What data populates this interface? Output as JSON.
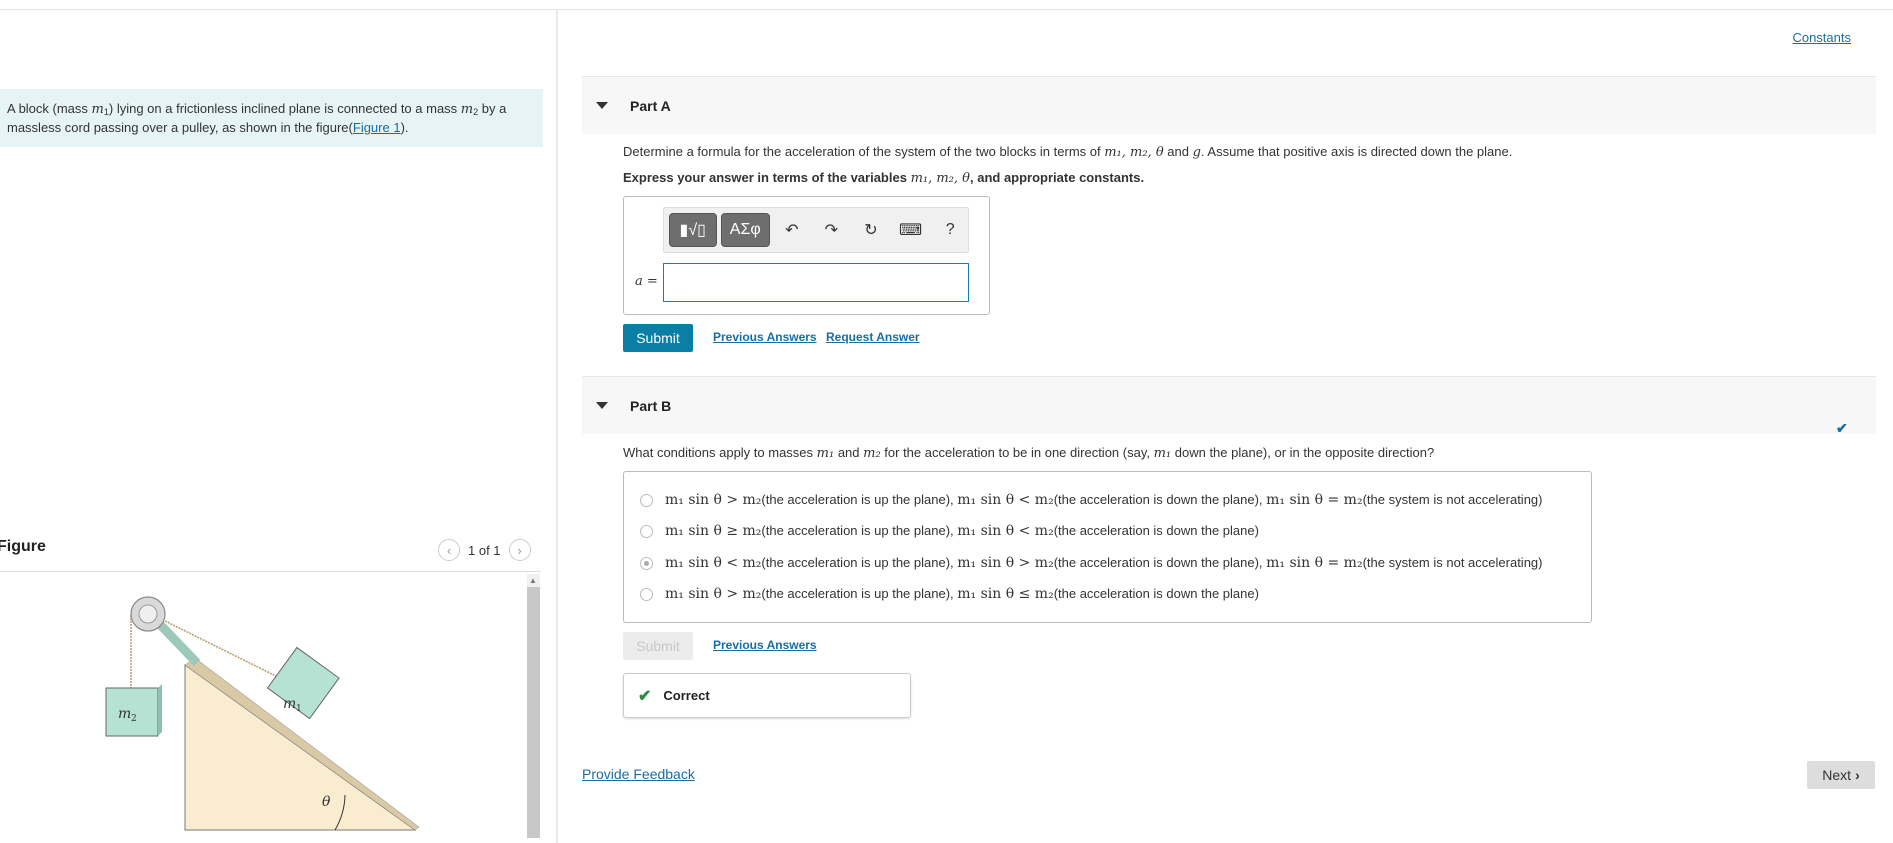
{
  "left": {
    "intro": {
      "pre": "A block (mass ",
      "m1_var": "m",
      "m1_sub": "1",
      "mid": ") lying on a frictionless inclined plane is connected to a mass ",
      "m2_var": "m",
      "m2_sub": "2",
      "post": " by a massless cord passing over a pulley, as shown in the figure(",
      "fig_link": "Figure 1",
      "end": ")."
    },
    "figure_title": "Figure",
    "pager": {
      "text": "1 of 1",
      "prev_icon": "chevron-left-icon",
      "next_icon": "chevron-right-icon"
    },
    "figure_labels": {
      "m1": "m",
      "m1_sub": "1",
      "m2": "m",
      "m2_sub": "2",
      "theta": "θ"
    },
    "colors": {
      "incline": "#faedcf",
      "block": "#b5e2d2",
      "pulley": "#d9d9d9"
    }
  },
  "right": {
    "constants_link": "Constants",
    "partA": {
      "title": "Part A",
      "question_pre": "Determine a formula for the acceleration of the system of the two blocks in terms of ",
      "question_vars": "m₁, m₂, θ",
      "question_and": " and ",
      "question_g": "g",
      "question_post": ". Assume that positive axis is directed down the plane.",
      "instruction_pre": "Express your answer in terms of the variables ",
      "instruction_vars": "m₁, m₂, θ",
      "instruction_post": ", and appropriate constants.",
      "toolbar": {
        "template_icon": "▮√▯",
        "symbols_label": "ΑΣφ",
        "undo_icon": "↶",
        "redo_icon": "↷",
        "reset_icon": "↻",
        "keyboard_icon": "⌨",
        "help_label": "?"
      },
      "answer_label": "a =",
      "answer_value": "",
      "submit": "Submit",
      "previous_answers": "Previous Answers",
      "request_answer": "Request Answer"
    },
    "partB": {
      "title": "Part B",
      "question_pre": "What conditions apply to masses ",
      "question_m1": "m₁",
      "question_and": " and ",
      "question_m2": "m₂",
      "question_mid": " for the acceleration to be in one direction (say, ",
      "question_m1b": "m₁",
      "question_post": " down the plane), or in the opposite direction?",
      "options": [
        {
          "parts": [
            [
              "m",
              "m₁ sin θ > m₂"
            ],
            [
              "t",
              "(the acceleration is up the plane), "
            ],
            [
              "m",
              "m₁ sin  θ  <  m₂"
            ],
            [
              "t",
              "(the acceleration is down the plane), "
            ],
            [
              "m",
              "m₁ sin  θ  =  m₂"
            ],
            [
              "t",
              "(the system is not accelerating)"
            ]
          ],
          "selected": false
        },
        {
          "parts": [
            [
              "m",
              "m₁ sin  θ  ≥  m₂"
            ],
            [
              "t",
              "(the acceleration is up the plane), "
            ],
            [
              "m",
              "m₁ sin  θ  <  m₂"
            ],
            [
              "t",
              "(the acceleration is down the plane)"
            ]
          ],
          "selected": false
        },
        {
          "parts": [
            [
              "m",
              "m₁ sin  θ  <  m₂"
            ],
            [
              "t",
              "(the acceleration is up the plane), "
            ],
            [
              "m",
              "m₁ sin  θ  >  m₂"
            ],
            [
              "t",
              "(the acceleration is down the plane), "
            ],
            [
              "m",
              "m₁ sin  θ  =  m₂"
            ],
            [
              "t",
              "(the system is not accelerating)"
            ]
          ],
          "selected": true
        },
        {
          "parts": [
            [
              "m",
              "m₁ sin  θ  >  m₂"
            ],
            [
              "t",
              "(the acceleration is up the plane), "
            ],
            [
              "m",
              "m₁ sin  θ  ≤  m₂"
            ],
            [
              "t",
              "(the acceleration is down the plane)"
            ]
          ],
          "selected": false
        }
      ],
      "submit": "Submit",
      "previous_answers": "Previous Answers",
      "feedback_label": "Correct",
      "status_icon": "check-icon"
    },
    "provide_feedback": "Provide Feedback",
    "next": "Next",
    "colors": {
      "accent": "#0a7ea4",
      "link": "#1a6da3",
      "correct": "#2b8a3e"
    }
  }
}
